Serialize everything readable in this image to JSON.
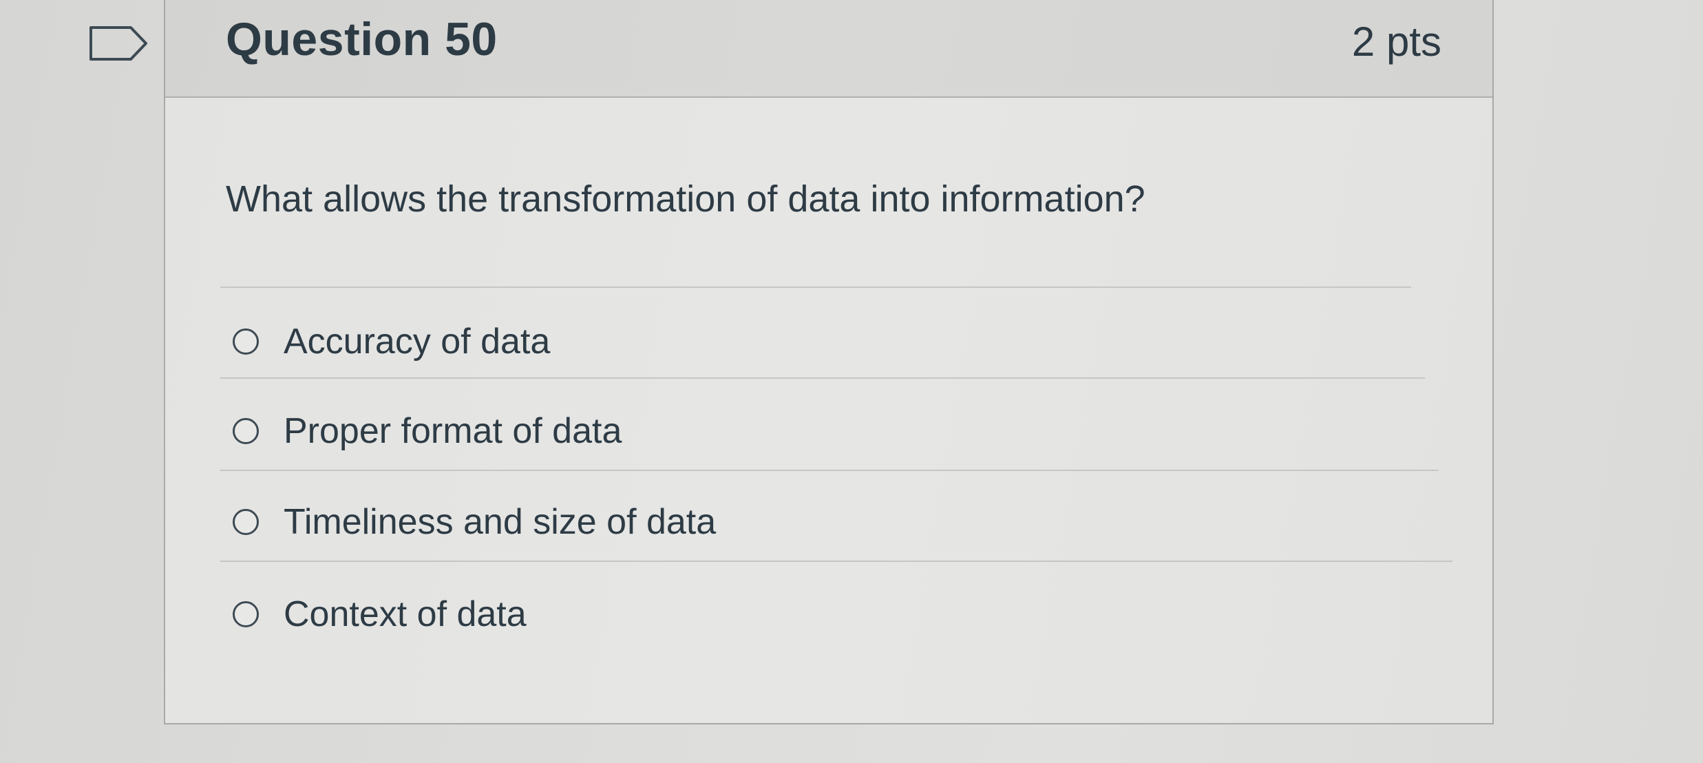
{
  "question": {
    "title": "Question 50",
    "points": "2 pts",
    "text": "What allows the transformation of data into information?",
    "answers": [
      {
        "label": "Accuracy of data",
        "selected": false
      },
      {
        "label": "Proper format of data",
        "selected": false
      },
      {
        "label": "Timeliness and size of data",
        "selected": false
      },
      {
        "label": "Context of data",
        "selected": false
      }
    ]
  },
  "icons": {
    "flag": "flag-question-icon"
  }
}
